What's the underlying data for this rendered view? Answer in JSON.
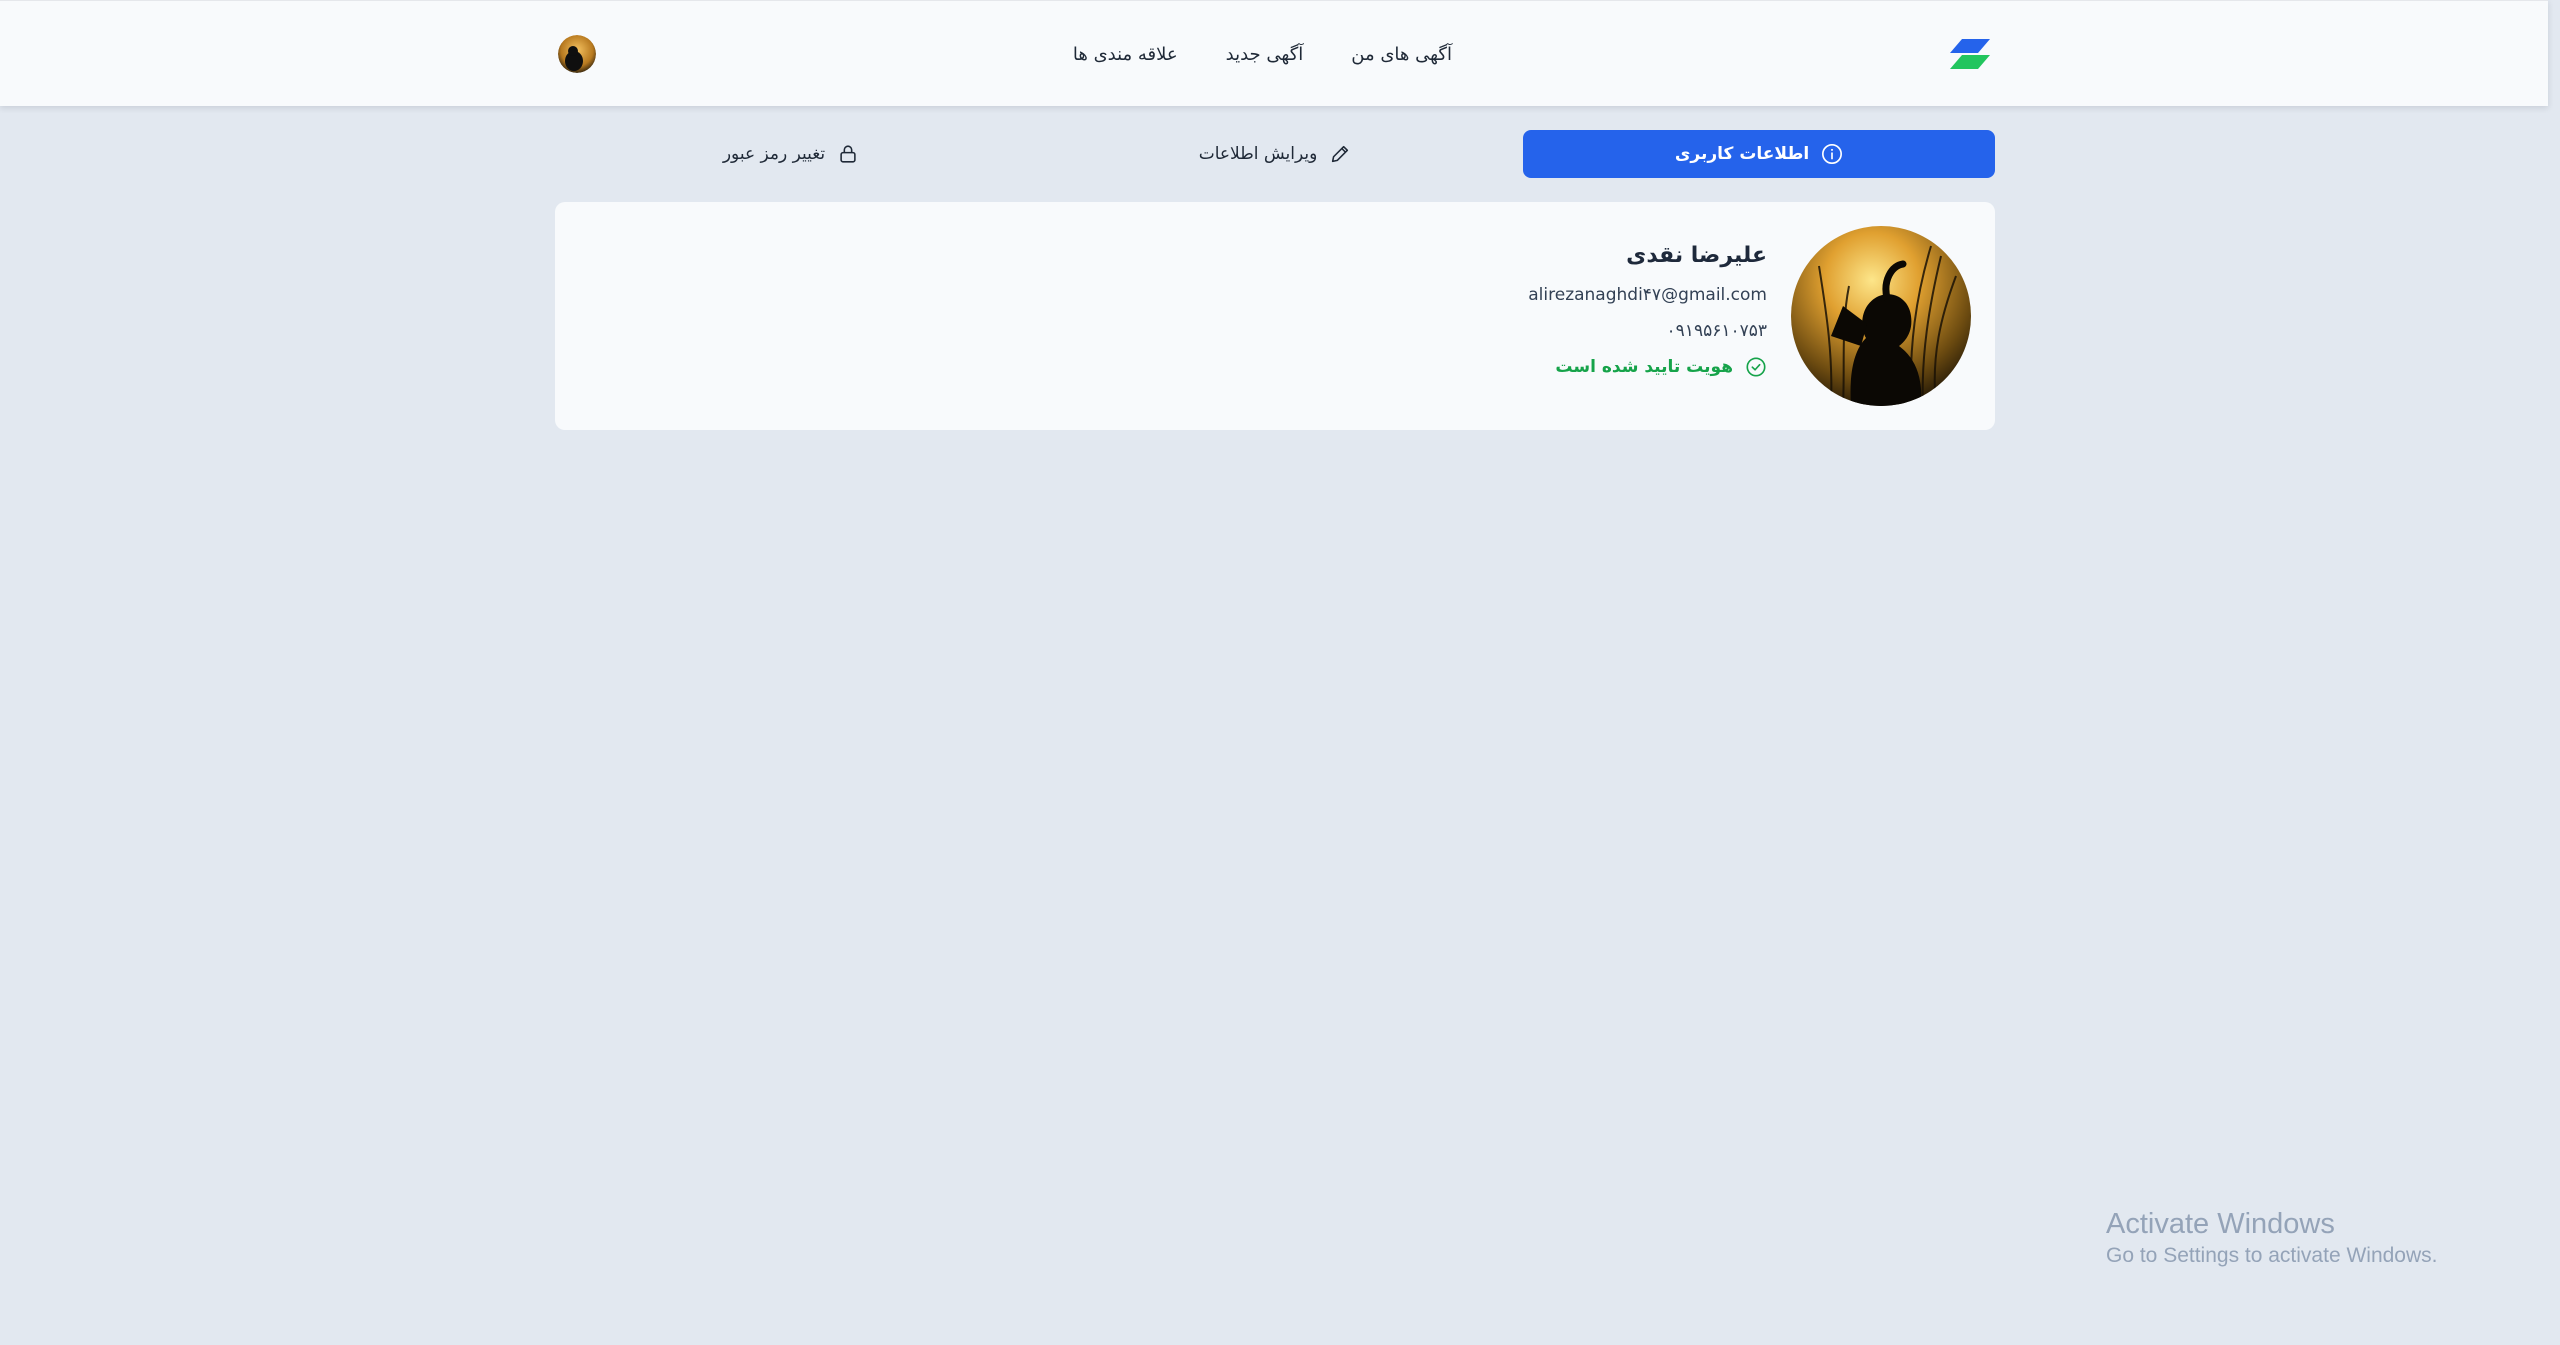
{
  "nav": {
    "logo_icon": "logo-icon",
    "links": [
      {
        "label": "آگهی های من"
      },
      {
        "label": "آگهی جدید"
      },
      {
        "label": "علاقه مندی ها"
      }
    ],
    "avatar_icon": "user-avatar"
  },
  "tabs": {
    "info_label": "اطلاعات کاربری",
    "edit_label": "ویرایش اطلاعات",
    "password_label": "تغییر رمز عبور"
  },
  "profile": {
    "name": "علیرضا نقدی",
    "email": "alirezanaghdi۴۷@gmail.com",
    "phone": "۰۹۱۹۵۶۱۰۷۵۳",
    "verified_label": "هویت تایید شده است"
  },
  "watermark": {
    "title": "Activate Windows",
    "subtitle": "Go to Settings to activate Windows."
  },
  "colors": {
    "primary": "#2563eb",
    "success": "#16a34a",
    "background": "#e2e8f0",
    "card": "#f8fafc"
  }
}
